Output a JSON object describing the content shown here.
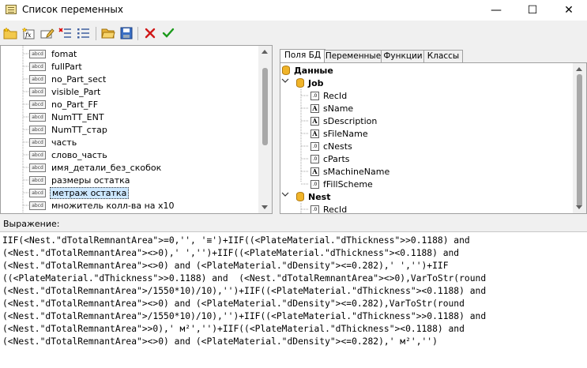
{
  "window": {
    "title": "Список переменных",
    "minimize": "—",
    "maximize": "☐",
    "close": "✕"
  },
  "toolbar": {
    "buttons": [
      "new-folder-icon",
      "new-function-icon",
      "edit-icon",
      "delete-list-icon",
      "list-icon",
      "open-folder-icon",
      "save-icon",
      "cancel-icon",
      "ok-icon"
    ]
  },
  "left_tree": {
    "items": [
      {
        "label": "fomat"
      },
      {
        "label": "fullPart"
      },
      {
        "label": "no_Part_sect"
      },
      {
        "label": "visible_Part"
      },
      {
        "label": "no_Part_FF"
      },
      {
        "label": "NumTT_ENT"
      },
      {
        "label": "NumTT_стар"
      },
      {
        "label": "часть"
      },
      {
        "label": "слово_часть"
      },
      {
        "label": "имя_детали_без_скобок"
      },
      {
        "label": "размеры остатка"
      },
      {
        "label": "метраж остатка",
        "selected": true
      },
      {
        "label": "множитель колл-ва на х10"
      }
    ],
    "icon_text": "abcd"
  },
  "tabs": [
    {
      "label": "Поля БД",
      "active": true
    },
    {
      "label": "Переменные"
    },
    {
      "label": "Функции"
    },
    {
      "label": "Классы"
    }
  ],
  "right_tree": {
    "root": "Данные",
    "job": {
      "label": "Job",
      "fields": [
        {
          "label": "RecId",
          "type": "num"
        },
        {
          "label": "sName",
          "type": "text"
        },
        {
          "label": "sDescription",
          "type": "text"
        },
        {
          "label": "sFileName",
          "type": "text"
        },
        {
          "label": "cNests",
          "type": "num"
        },
        {
          "label": "cParts",
          "type": "num"
        },
        {
          "label": "sMachineName",
          "type": "text"
        },
        {
          "label": "fFillScheme",
          "type": "num"
        }
      ]
    },
    "nest": {
      "label": "Nest",
      "fields": [
        {
          "label": "RecId",
          "type": "num"
        }
      ]
    },
    "num_icon_text": ".0",
    "text_icon_text": "A"
  },
  "expression": {
    "label": "Выражение:",
    "lines": [
      "IIF(<Nest.\"dTotalRemnantArea\">=0,'', '≡')+IIF((<PlateMaterial.\"dThickness\">>0.1188) and",
      "(<Nest.\"dTotalRemnantArea\"><>0),' ','')+IIF((<PlateMaterial.\"dThickness\"><0.1188) and",
      "(<Nest.\"dTotalRemnantArea\"><>0) and (<PlateMaterial.\"dDensity\"><=0.282),' ','')+IIF",
      "((<PlateMaterial.\"dThickness\">>0.1188) and  (<Nest.\"dTotalRemnantArea\"><>0),VarToStr(round",
      "(<Nest.\"dTotalRemnantArea\">/1550*10)/10),'')+IIF((<PlateMaterial.\"dThickness\"><0.1188) and",
      "(<Nest.\"dTotalRemnantArea\"><>0) and (<PlateMaterial.\"dDensity\"><=0.282),VarToStr(round",
      "(<Nest.\"dTotalRemnantArea\">/1550*10)/10),'')+IIF((<PlateMaterial.\"dThickness\">>0.1188) and",
      "(<Nest.\"dTotalRemnantArea\">>0),' м²','')+IIF((<PlateMaterial.\"dThickness\"><0.1188) and",
      "(<Nest.\"dTotalRemnantArea\"><>0) and (<PlateMaterial.\"dDensity\"><=0.282),' м²','')"
    ]
  }
}
